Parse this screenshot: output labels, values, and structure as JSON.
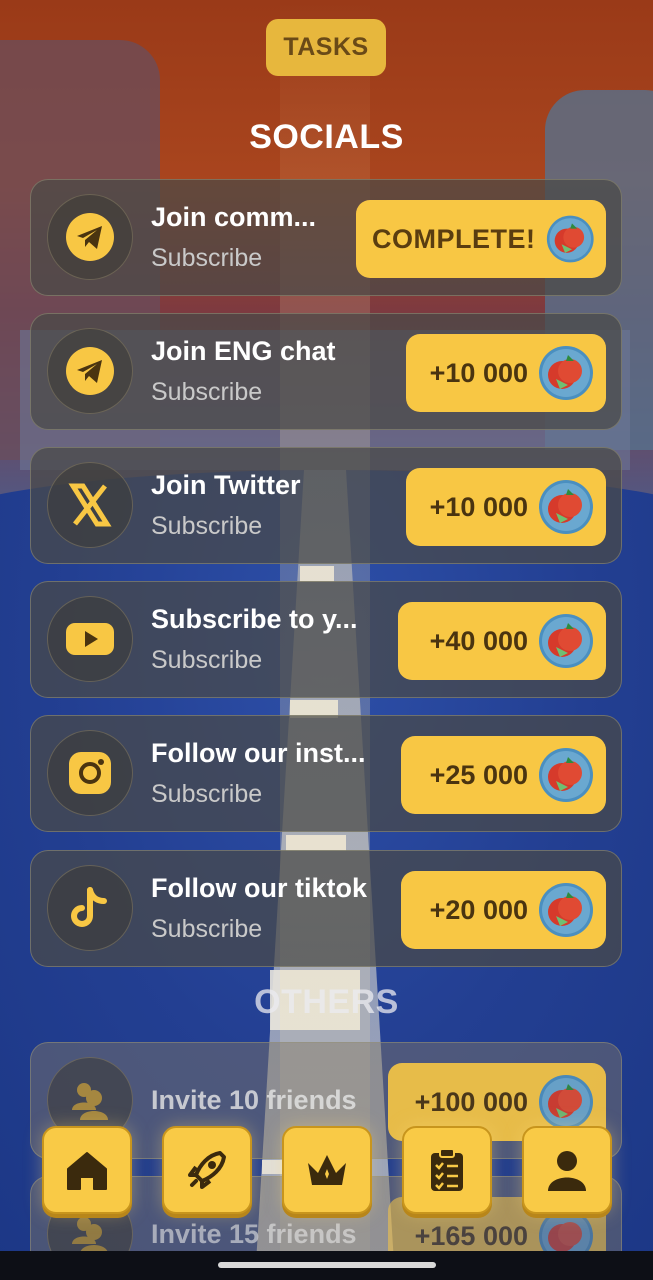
{
  "header": {
    "tab_label": "TASKS"
  },
  "sections": {
    "socials_title": "SOCIALS",
    "others_title": "OTHERS"
  },
  "socials": [
    {
      "title": "Join comm...",
      "subtitle": "Subscribe",
      "reward": "COMPLETE!",
      "icon": "telegram-icon"
    },
    {
      "title": "Join ENG chat",
      "subtitle": "Subscribe",
      "reward": "+10 000",
      "icon": "telegram-icon"
    },
    {
      "title": "Join Twitter",
      "subtitle": "Subscribe",
      "reward": "+10 000",
      "icon": "x-icon"
    },
    {
      "title": "Subscribe to y...",
      "subtitle": "Subscribe",
      "reward": "+40 000",
      "icon": "youtube-icon"
    },
    {
      "title": "Follow our inst...",
      "subtitle": "Subscribe",
      "reward": "+25 000",
      "icon": "instagram-icon"
    },
    {
      "title": "Follow our tiktok",
      "subtitle": "Subscribe",
      "reward": "+20 000",
      "icon": "tiktok-icon"
    }
  ],
  "others": [
    {
      "title": "Invite 10 friends",
      "reward": "+100 000",
      "icon": "friends-icon"
    },
    {
      "title": "Invite 15 friends",
      "reward": "+165 000",
      "icon": "friends-icon"
    }
  ],
  "nav": [
    {
      "name": "home",
      "icon": "home-icon"
    },
    {
      "name": "boost",
      "icon": "rocket-icon"
    },
    {
      "name": "league",
      "icon": "crown-icon"
    },
    {
      "name": "tasks",
      "icon": "clipboard-icon"
    },
    {
      "name": "profile",
      "icon": "user-icon"
    }
  ],
  "colors": {
    "accent": "#f8c744",
    "accent_text": "#4a3410",
    "card_bg": "#4a4a46",
    "ground": "#233f92"
  }
}
